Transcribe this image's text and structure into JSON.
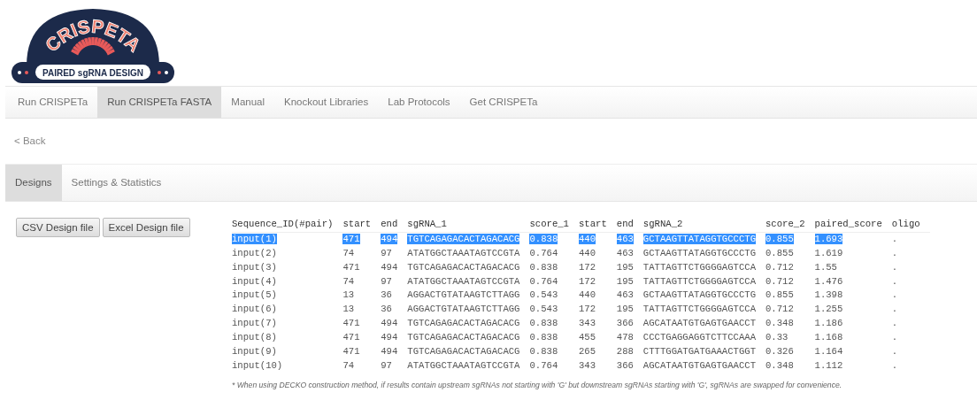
{
  "logo": {
    "title": "CRISPETA",
    "subtitle": "PAIRED sgRNA DESIGN"
  },
  "nav": [
    {
      "label": "Run CRISPETa",
      "selected": false
    },
    {
      "label": "Run CRISPETa FASTA",
      "selected": true
    },
    {
      "label": "Manual",
      "selected": false
    },
    {
      "label": "Knockout Libraries",
      "selected": false
    },
    {
      "label": "Lab Protocols",
      "selected": false
    },
    {
      "label": "Get CRISPETa",
      "selected": false
    }
  ],
  "back_link": "< Back",
  "tabs": [
    {
      "label": "Designs",
      "selected": true
    },
    {
      "label": "Settings & Statistics",
      "selected": false
    }
  ],
  "buttons": [
    "CSV Design file",
    "Excel Design file"
  ],
  "table": {
    "columns": [
      "Sequence_ID(#pair)",
      "start",
      "end",
      "sgRNA_1",
      "score_1",
      "start",
      "end",
      "sgRNA_2",
      "score_2",
      "paired_score",
      "oligo"
    ],
    "rows": [
      {
        "selected": true,
        "cells": [
          "input(1)",
          "471",
          "494",
          "TGTCAGAGACACTAGACACG",
          "0.838",
          "440",
          "463",
          "GCTAAGTTATAGGTGCCCTG",
          "0.855",
          "1.693",
          "."
        ]
      },
      {
        "selected": false,
        "cells": [
          "input(2)",
          "74",
          "97",
          "ATATGGCTAAATAGTCCGTA",
          "0.764",
          "440",
          "463",
          "GCTAAGTTATAGGTGCCCTG",
          "0.855",
          "1.619",
          "."
        ]
      },
      {
        "selected": false,
        "cells": [
          "input(3)",
          "471",
          "494",
          "TGTCAGAGACACTAGACACG",
          "0.838",
          "172",
          "195",
          "TATTAGTTCTGGGGAGTCCA",
          "0.712",
          "1.55",
          "."
        ]
      },
      {
        "selected": false,
        "cells": [
          "input(4)",
          "74",
          "97",
          "ATATGGCTAAATAGTCCGTA",
          "0.764",
          "172",
          "195",
          "TATTAGTTCTGGGGAGTCCA",
          "0.712",
          "1.476",
          "."
        ]
      },
      {
        "selected": false,
        "cells": [
          "input(5)",
          "13",
          "36",
          "AGGACTGTATAAGTCTTAGG",
          "0.543",
          "440",
          "463",
          "GCTAAGTTATAGGTGCCCTG",
          "0.855",
          "1.398",
          "."
        ]
      },
      {
        "selected": false,
        "cells": [
          "input(6)",
          "13",
          "36",
          "AGGACTGTATAAGTCTTAGG",
          "0.543",
          "172",
          "195",
          "TATTAGTTCTGGGGAGTCCA",
          "0.712",
          "1.255",
          "."
        ]
      },
      {
        "selected": false,
        "cells": [
          "input(7)",
          "471",
          "494",
          "TGTCAGAGACACTAGACACG",
          "0.838",
          "343",
          "366",
          "AGCATAATGTGAGTGAACCT",
          "0.348",
          "1.186",
          "."
        ]
      },
      {
        "selected": false,
        "cells": [
          "input(8)",
          "471",
          "494",
          "TGTCAGAGACACTAGACACG",
          "0.838",
          "455",
          "478",
          "CCCTGAGGAGGTCTTCCAAA",
          "0.33",
          "1.168",
          "."
        ]
      },
      {
        "selected": false,
        "cells": [
          "input(9)",
          "471",
          "494",
          "TGTCAGAGACACTAGACACG",
          "0.838",
          "265",
          "288",
          "CTTTGGATGATGAAACTGGT",
          "0.326",
          "1.164",
          "."
        ]
      },
      {
        "selected": false,
        "cells": [
          "input(10)",
          "74",
          "97",
          "ATATGGCTAAATAGTCCGTA",
          "0.764",
          "343",
          "366",
          "AGCATAATGTGAGTGAACCT",
          "0.348",
          "1.112",
          "."
        ]
      }
    ]
  },
  "footnote": "* When using DECKO construction method, if results contain upstream sgRNAs not starting with 'G' but downstream sgRNAs starting with 'G', sgRNAs are swapped for convenience."
}
